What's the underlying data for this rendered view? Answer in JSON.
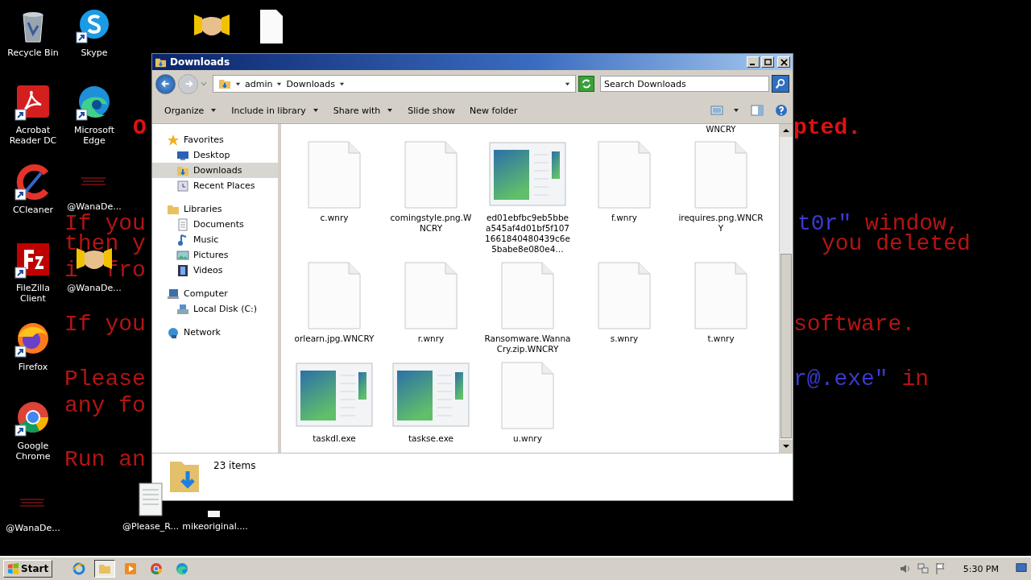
{
  "wallpaper_lines": [
    {
      "left": [
        {
          "text": "O",
          "color": "#e01010"
        }
      ],
      "right": [
        {
          "text": "pted.",
          "color": "#e01010"
        }
      ],
      "bold": true
    },
    {
      "left": [
        {
          "text": "If you",
          "color": "#b41414"
        }
      ],
      "right": [
        {
          "text": "t0r\"",
          "color": "#3a3ad0"
        },
        {
          "text": " window,",
          "color": "#b41414"
        }
      ],
      "bold": false
    },
    {
      "left": [
        {
          "text": "then y",
          "color": "#b41414"
        }
      ],
      "right": [
        {
          "text": "you deleted",
          "color": "#b41414"
        }
      ],
      "bold": false
    },
    {
      "left": [
        {
          "text": "i  fro",
          "color": "#b41414"
        }
      ],
      "bold": false
    },
    {
      "left": [
        {
          "text": "If you",
          "color": "#b41414"
        }
      ],
      "right": [
        {
          "text": "software.",
          "color": "#b41414"
        }
      ],
      "bold": false
    },
    {
      "left": [
        {
          "text": "Please",
          "color": "#b41414"
        }
      ],
      "right": [
        {
          "text": "r@.exe\"",
          "color": "#3a3ad0"
        },
        {
          "text": " in",
          "color": "#b41414"
        }
      ],
      "bold": false
    },
    {
      "left": [
        {
          "text": "any fo",
          "color": "#b41414"
        }
      ],
      "bold": false
    },
    {
      "left": [
        {
          "text": "Run an",
          "color": "#b41414"
        }
      ],
      "bold": false
    }
  ],
  "desktop_icons": [
    {
      "label": "Recycle Bin",
      "kind": "recycle",
      "shortcut": false
    },
    {
      "label": "Skype",
      "kind": "skype",
      "shortcut": true
    },
    {
      "label": "Acrobat Reader DC",
      "kind": "acrobat",
      "shortcut": true
    },
    {
      "label": "Microsoft Edge",
      "kind": "edge",
      "shortcut": true
    },
    {
      "label": "CCleaner",
      "kind": "ccleaner",
      "shortcut": true
    },
    {
      "label": "@WanaDe...",
      "kind": "wanatext",
      "shortcut": false
    },
    {
      "label": "FileZilla Client",
      "kind": "filezilla",
      "shortcut": true
    },
    {
      "label": "@WanaDe...",
      "kind": "handshake",
      "shortcut": false
    },
    {
      "label": "Firefox",
      "kind": "firefox",
      "shortcut": true
    },
    {
      "label": "Google Chrome",
      "kind": "chrome",
      "shortcut": true
    },
    {
      "label": "@WanaDe...",
      "kind": "wanatext",
      "shortcut": false
    },
    {
      "label": "@Please_R...",
      "kind": "textfile",
      "shortcut": false
    },
    {
      "label": "mikeoriginal....",
      "kind": "blank",
      "shortcut": false
    },
    {
      "kind": "handshake",
      "shortcut": false
    },
    {
      "kind": "page",
      "shortcut": false
    }
  ],
  "window": {
    "title": "Downloads",
    "breadcrumbs": [
      "admin",
      "Downloads"
    ],
    "search": {
      "placeholder": "Search Downloads"
    },
    "toolbar": [
      {
        "label": "Organize",
        "menu": true
      },
      {
        "label": "Include in library",
        "menu": true
      },
      {
        "label": "Share with",
        "menu": true
      },
      {
        "label": "Slide show",
        "menu": false
      },
      {
        "label": "New folder",
        "menu": false
      }
    ],
    "nav": [
      {
        "label": "Favorites",
        "kind": "star",
        "selected": false,
        "children": [
          {
            "label": "Desktop",
            "kind": "desktop",
            "selected": false
          },
          {
            "label": "Downloads",
            "kind": "downloads",
            "selected": true
          },
          {
            "label": "Recent Places",
            "kind": "recent",
            "selected": false
          }
        ]
      },
      {
        "label": "Libraries",
        "kind": "library",
        "selected": false,
        "children": [
          {
            "label": "Documents",
            "kind": "documents",
            "selected": false
          },
          {
            "label": "Music",
            "kind": "music",
            "selected": false
          },
          {
            "label": "Pictures",
            "kind": "pictures",
            "selected": false
          },
          {
            "label": "Videos",
            "kind": "videos",
            "selected": false
          }
        ]
      },
      {
        "label": "Computer",
        "kind": "computer",
        "selected": false,
        "children": [
          {
            "label": "Local Disk (C:)",
            "kind": "disk",
            "selected": false
          }
        ]
      },
      {
        "label": "Network",
        "kind": "network",
        "selected": false
      }
    ],
    "partial_label": "WNCRY",
    "files": [
      {
        "name": "c.wnry",
        "kind": "document"
      },
      {
        "name": "comingstyle.png.WNCRY",
        "kind": "document"
      },
      {
        "name": "ed01ebfbc9eb5bbea545af4d01bf5f1071661840480439c6e5babe8e080e4…",
        "kind": "app"
      },
      {
        "name": "f.wnry",
        "kind": "document"
      },
      {
        "name": "irequires.png.WNCRY",
        "kind": "document"
      },
      {
        "name": "orlearn.jpg.WNCRY",
        "kind": "document"
      },
      {
        "name": "r.wnry",
        "kind": "document"
      },
      {
        "name": "Ransomware.WannaCry.zip.WNCRY",
        "kind": "document"
      },
      {
        "name": "s.wnry",
        "kind": "document"
      },
      {
        "name": "t.wnry",
        "kind": "document"
      },
      {
        "name": "taskdl.exe",
        "kind": "app"
      },
      {
        "name": "taskse.exe",
        "kind": "app"
      },
      {
        "name": "u.wnry",
        "kind": "document"
      }
    ],
    "status": "23 items"
  },
  "taskbar": {
    "start": "Start",
    "apps": [
      {
        "kind": "ie",
        "selected": false
      },
      {
        "kind": "explorer",
        "selected": true
      },
      {
        "kind": "media",
        "selected": false
      },
      {
        "kind": "chrome",
        "selected": false
      },
      {
        "kind": "edge",
        "selected": false
      }
    ],
    "clock": "5:30 PM"
  }
}
